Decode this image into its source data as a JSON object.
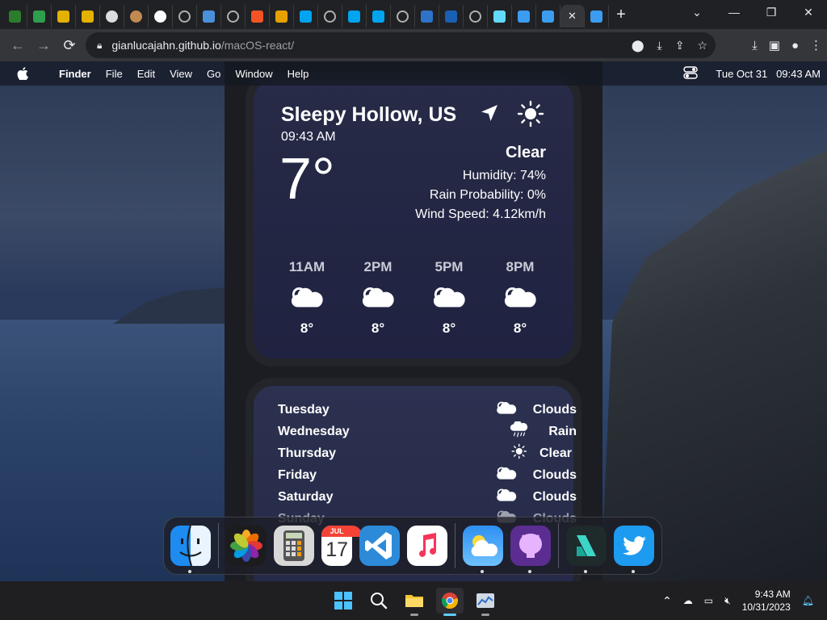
{
  "browser": {
    "url_host": "gianlucajahn.github.io",
    "url_path": "/macOS-react/",
    "tabs": [
      {
        "icon": "jupyter-favicon",
        "color": "#2b7d2b"
      },
      {
        "icon": "spreadsheet-favicon",
        "color": "#2e9f4d"
      },
      {
        "icon": "yellow-gear-favicon",
        "color": "#e3b100"
      },
      {
        "icon": "yellow-gear-favicon",
        "color": "#e3b100"
      },
      {
        "icon": "shield-favicon",
        "color": "#dddddd"
      },
      {
        "icon": "dog-favicon",
        "color": "#c08a52"
      },
      {
        "icon": "github-favicon",
        "color": "#ffffff"
      },
      {
        "icon": "globe-favicon",
        "color": "#b0b0b0"
      },
      {
        "icon": "blue-window-favicon",
        "color": "#4a90d9"
      },
      {
        "icon": "globe-favicon",
        "color": "#b0b0b0"
      },
      {
        "icon": "windows-color-favicon",
        "color": "#f35325"
      },
      {
        "icon": "windows-color-favicon",
        "color": "#e6a100"
      },
      {
        "icon": "windows-favicon",
        "color": "#00a4ef"
      },
      {
        "icon": "globe-favicon",
        "color": "#b0b0b0"
      },
      {
        "icon": "windows-favicon",
        "color": "#00a4ef"
      },
      {
        "icon": "windows-favicon",
        "color": "#00a4ef"
      },
      {
        "icon": "globe-favicon",
        "color": "#b0b0b0"
      },
      {
        "icon": "blue-square-favicon",
        "color": "#2f73c8"
      },
      {
        "icon": "blue-bar-favicon",
        "color": "#1a5fb4"
      },
      {
        "icon": "globe-favicon",
        "color": "#b0b0b0"
      },
      {
        "icon": "react-favicon",
        "color": "#61dafb"
      },
      {
        "icon": "finder-favicon",
        "color": "#3c9cf0"
      },
      {
        "icon": "finder-favicon",
        "color": "#3c9cf0"
      },
      {
        "icon": "close-icon",
        "color": "#e8eaed",
        "active": true
      },
      {
        "icon": "finder-favicon",
        "color": "#3c9cf0"
      }
    ],
    "new_tab": "+"
  },
  "menubar": {
    "app": "Finder",
    "items": [
      "File",
      "Edit",
      "View",
      "Go",
      "Window",
      "Help"
    ],
    "date": "Tue Oct 31",
    "time": "09:43 AM"
  },
  "weather": {
    "city": "Sleepy Hollow, US",
    "local_time": "09:43 AM",
    "temperature": "7°",
    "condition": "Clear",
    "humidity": "Humidity: 74%",
    "rain": "Rain Probability: 0%",
    "wind": "Wind Speed: 4.12km/h",
    "hourly": [
      {
        "time": "11AM",
        "temp": "8°",
        "icon": "cloud-icon"
      },
      {
        "time": "2PM",
        "temp": "8°",
        "icon": "cloud-icon"
      },
      {
        "time": "5PM",
        "temp": "8°",
        "icon": "cloud-icon"
      },
      {
        "time": "8PM",
        "temp": "8°",
        "icon": "cloud-icon"
      }
    ],
    "daily": [
      {
        "day": "Tuesday",
        "cond": "Clouds",
        "icon": "cloud-icon"
      },
      {
        "day": "Wednesday",
        "cond": "Rain",
        "icon": "rain-icon"
      },
      {
        "day": "Thursday",
        "cond": "Clear",
        "icon": "sun-icon"
      },
      {
        "day": "Friday",
        "cond": "Clouds",
        "icon": "cloud-icon"
      },
      {
        "day": "Saturday",
        "cond": "Clouds",
        "icon": "cloud-icon"
      },
      {
        "day": "Sunday",
        "cond": "Clouds",
        "icon": "cloud-icon"
      }
    ]
  },
  "dock": {
    "apps": [
      {
        "name": "finder",
        "running": true
      },
      {
        "name": "photos",
        "running": false
      },
      {
        "name": "calculator",
        "running": false
      },
      {
        "name": "calendar",
        "running": false,
        "month": "JUL",
        "day": "17"
      },
      {
        "name": "vscode",
        "running": false
      },
      {
        "name": "music",
        "running": false
      },
      {
        "name": "weather",
        "running": true
      },
      {
        "name": "github",
        "running": true
      },
      {
        "name": "spotify-like",
        "running": true
      },
      {
        "name": "twitter",
        "running": true
      }
    ]
  },
  "taskbar": {
    "time": "9:43 AM",
    "date": "10/31/2023"
  },
  "colors": {
    "accent": "#60cdff",
    "card_bg": "#272b47",
    "panel_bg": "#1b1d22"
  }
}
